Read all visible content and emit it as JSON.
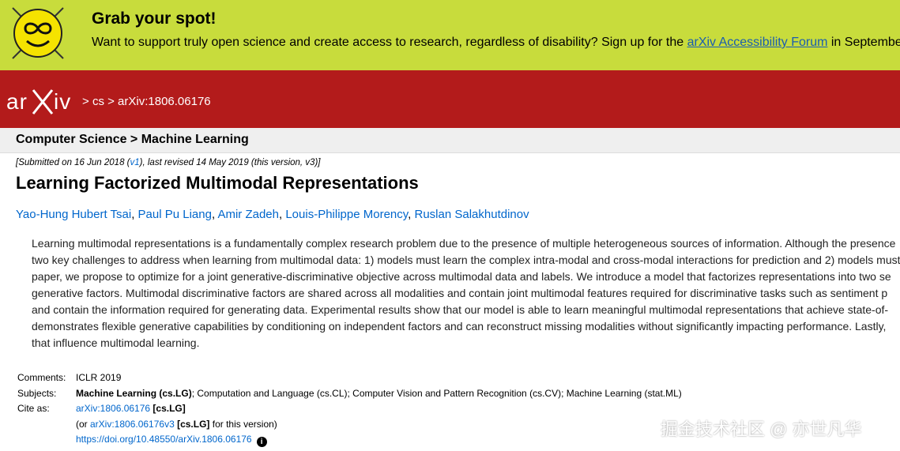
{
  "banner": {
    "title": "Grab your spot!",
    "text_prefix": "Want to support truly open science and create access to research, regardless of disability? Sign up for the ",
    "link": "arXiv Accessibility Forum",
    "text_suffix": " in September"
  },
  "header": {
    "logo": "arXiv",
    "crumb_sep1": " > ",
    "crumb_cs": "cs",
    "crumb_sep2": " > ",
    "crumb_id": "arXiv:1806.06176"
  },
  "subheader": "Computer Science > Machine Learning",
  "dateline": {
    "prefix": "[Submitted on 16 Jun 2018 (",
    "v1": "v1",
    "suffix": "), last revised 14 May 2019 (this version, v3)]"
  },
  "title": "Learning Factorized Multimodal Representations",
  "authors": [
    "Yao-Hung Hubert Tsai",
    "Paul Pu Liang",
    "Amir Zadeh",
    "Louis-Philippe Morency",
    "Ruslan Salakhutdinov"
  ],
  "abstract_lines": [
    "Learning multimodal representations is a fundamentally complex research problem due to the presence of multiple heterogeneous sources of information. Although the presence",
    "two key challenges to address when learning from multimodal data: 1) models must learn the complex intra-modal and cross-modal interactions for prediction and 2) models must",
    "paper, we propose to optimize for a joint generative-discriminative objective across multimodal data and labels. We introduce a model that factorizes representations into two se",
    "generative factors. Multimodal discriminative factors are shared across all modalities and contain joint multimodal features required for discriminative tasks such as sentiment p",
    "and contain the information required for generating data. Experimental results show that our model is able to learn meaningful multimodal representations that achieve state-of-",
    "demonstrates flexible generative capabilities by conditioning on independent factors and can reconstruct missing modalities without significantly impacting performance. Lastly,",
    "that influence multimodal learning."
  ],
  "meta": {
    "comments_label": "Comments:",
    "comments": "ICLR 2019",
    "subjects_label": "Subjects:",
    "subjects_primary": "Machine Learning (cs.LG)",
    "subjects_rest": "; Computation and Language (cs.CL); Computer Vision and Pattern Recognition (cs.CV); Machine Learning (stat.ML)",
    "cite_label": "Cite as:",
    "cite_id": "arXiv:1806.06176",
    "cite_cat": " [cs.LG]",
    "cite2_prefix": "(or ",
    "cite2_id": "arXiv:1806.06176v3",
    "cite2_cat": " [cs.LG]",
    "cite2_suffix": " for this version)",
    "doi": "https://doi.org/10.48550/arXiv.1806.06176",
    "info_glyph": "i"
  },
  "watermark": "掘金技术社区 @ 亦世凡华"
}
